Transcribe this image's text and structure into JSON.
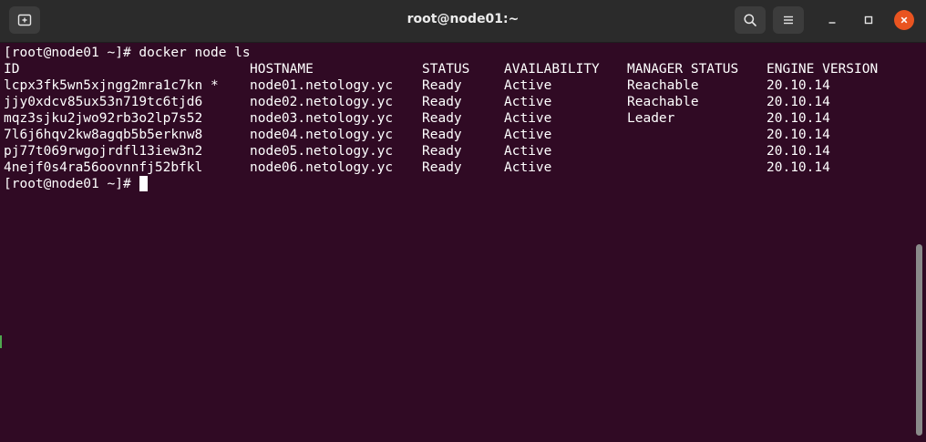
{
  "window": {
    "title": "root@node01:~"
  },
  "titlebar_icons": {
    "new_tab": "new-tab-icon",
    "search": "search-icon",
    "menu": "hamburger-menu-icon",
    "minimize": "minimize-icon",
    "maximize": "maximize-icon",
    "close": "close-icon"
  },
  "colors": {
    "terminal_bg": "#300a24",
    "terminal_fg": "#ffffff",
    "titlebar_bg": "#2b2b2b",
    "close_button": "#e95420"
  },
  "terminal": {
    "command_line": "[root@node01 ~]# docker node ls",
    "headers": [
      "ID",
      "HOSTNAME",
      "STATUS",
      "AVAILABILITY",
      "MANAGER STATUS",
      "ENGINE VERSION"
    ],
    "rows": [
      [
        "lcpx3fk5wn5xjngg2mra1c7kn *",
        "node01.netology.yc",
        "Ready",
        "Active",
        "Reachable",
        "20.10.14"
      ],
      [
        "jjy0xdcv85ux53n719tc6tjd6",
        "node02.netology.yc",
        "Ready",
        "Active",
        "Reachable",
        "20.10.14"
      ],
      [
        "mqz3sjku2jwo92rb3o2lp7s52",
        "node03.netology.yc",
        "Ready",
        "Active",
        "Leader",
        "20.10.14"
      ],
      [
        "7l6j6hqv2kw8agqb5b5erknw8",
        "node04.netology.yc",
        "Ready",
        "Active",
        "",
        "20.10.14"
      ],
      [
        "pj77t069rwgojrdfl13iew3n2",
        "node05.netology.yc",
        "Ready",
        "Active",
        "",
        "20.10.14"
      ],
      [
        "4nejf0s4ra56oovnnfj52bfkl",
        "node06.netology.yc",
        "Ready",
        "Active",
        "",
        "20.10.14"
      ]
    ],
    "prompt": "[root@node01 ~]#"
  }
}
